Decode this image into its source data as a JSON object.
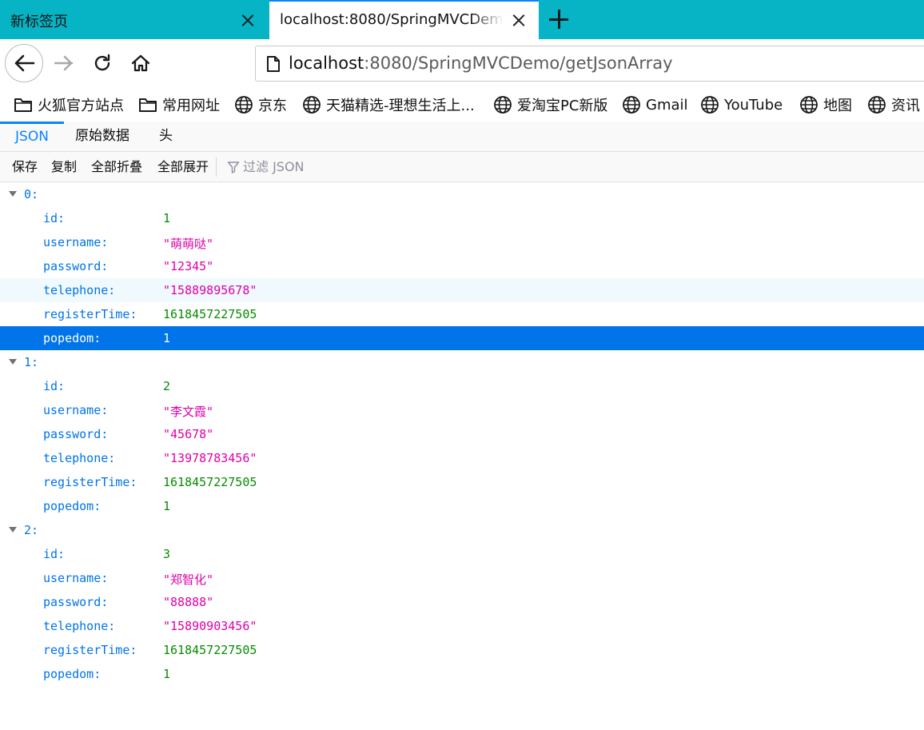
{
  "browser": {
    "tabs": [
      {
        "title": "新标签页",
        "active": false
      },
      {
        "title": "localhost:8080/SpringMVCDemo/getJsonArray",
        "active": true
      }
    ],
    "url": {
      "host": "localhost",
      "rest": ":8080/SpringMVCDemo/getJsonArray"
    },
    "bookmarks": [
      {
        "label": "火狐官方站点",
        "icon": "folder-icon"
      },
      {
        "label": "常用网址",
        "icon": "folder-icon"
      },
      {
        "label": "京东",
        "icon": "globe-icon"
      },
      {
        "label": "天猫精选-理想生活上...",
        "icon": "globe-icon"
      },
      {
        "label": "爱淘宝PC新版",
        "icon": "globe-icon"
      },
      {
        "label": "Gmail",
        "icon": "globe-icon"
      },
      {
        "label": "YouTube",
        "icon": "globe-icon"
      },
      {
        "label": "地图",
        "icon": "globe-icon"
      },
      {
        "label": "资讯",
        "icon": "globe-icon"
      }
    ],
    "accent": "#0a84ff",
    "tabbar_color": "#06b4c5"
  },
  "viewer": {
    "tabs": [
      "JSON",
      "原始数据",
      "头"
    ],
    "toolbar": {
      "save": "保存",
      "copy": "复制",
      "collapse_all": "全部折叠",
      "expand_all": "全部展开",
      "filter_placeholder": "过滤 JSON"
    },
    "colors": {
      "key": "#0074e8",
      "number": "#058b00",
      "string": "#dd00a9",
      "selected": "#0074e8"
    },
    "items": [
      {
        "index": "0:",
        "fields": [
          {
            "key": "id:",
            "value": "1",
            "type": "num"
          },
          {
            "key": "username:",
            "value": "\"萌萌哒\"",
            "type": "str"
          },
          {
            "key": "password:",
            "value": "\"12345\"",
            "type": "str"
          },
          {
            "key": "telephone:",
            "value": "\"15889895678\"",
            "type": "str",
            "state": "hover"
          },
          {
            "key": "registerTime:",
            "value": "1618457227505",
            "type": "num"
          },
          {
            "key": "popedom:",
            "value": "1",
            "type": "num",
            "state": "selected"
          }
        ]
      },
      {
        "index": "1:",
        "fields": [
          {
            "key": "id:",
            "value": "2",
            "type": "num"
          },
          {
            "key": "username:",
            "value": "\"李文霞\"",
            "type": "str"
          },
          {
            "key": "password:",
            "value": "\"45678\"",
            "type": "str"
          },
          {
            "key": "telephone:",
            "value": "\"13978783456\"",
            "type": "str"
          },
          {
            "key": "registerTime:",
            "value": "1618457227505",
            "type": "num"
          },
          {
            "key": "popedom:",
            "value": "1",
            "type": "num"
          }
        ]
      },
      {
        "index": "2:",
        "fields": [
          {
            "key": "id:",
            "value": "3",
            "type": "num"
          },
          {
            "key": "username:",
            "value": "\"郑智化\"",
            "type": "str"
          },
          {
            "key": "password:",
            "value": "\"88888\"",
            "type": "str"
          },
          {
            "key": "telephone:",
            "value": "\"15890903456\"",
            "type": "str"
          },
          {
            "key": "registerTime:",
            "value": "1618457227505",
            "type": "num"
          },
          {
            "key": "popedom:",
            "value": "1",
            "type": "num"
          }
        ]
      }
    ]
  }
}
